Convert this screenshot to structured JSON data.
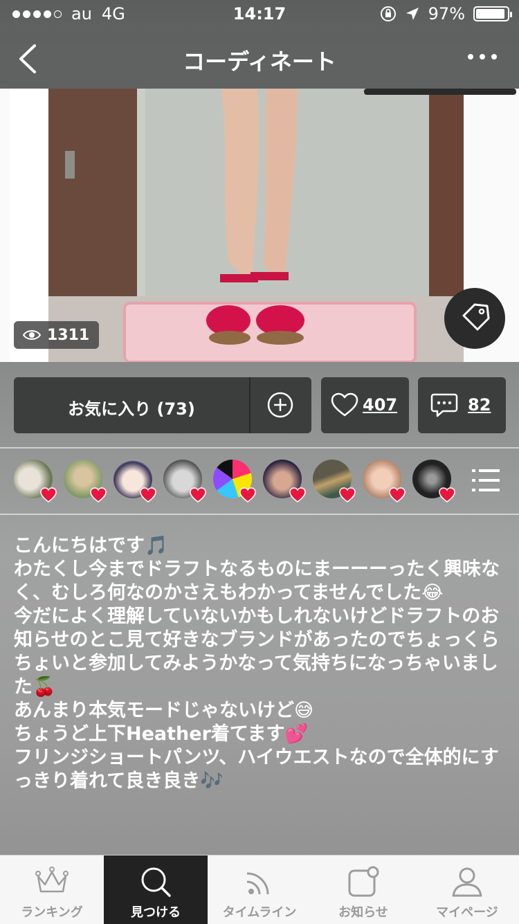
{
  "status_bar": {
    "carrier": "au",
    "network": "4G",
    "time": "14:17",
    "battery": "97%",
    "signal_bars": 4
  },
  "nav": {
    "title": "コーディネート",
    "back_icon": "chevron-left-icon",
    "more_icon": "more-dots-icon"
  },
  "photo": {
    "view_count": "1311",
    "tag_icon": "price-tag-icon"
  },
  "actions": {
    "favorite_label": "お気に入り (73)",
    "like_count": "407",
    "comment_count": "82"
  },
  "likers": {
    "count_shown": 9,
    "list_icon": "list-icon"
  },
  "description": {
    "lines": [
      "こんにちはです🎵",
      "",
      "わたくし今までドラフトなるものにまーーーったく興味なく、むしろ何なのかさえもわかってませんでした😂",
      "今だによく理解していないかもしれないけどドラフトのお知らせのとこ見て好きなブランドがあったのでちょっくらちょいと参加してみようかなって気持ちになっちゃいました🍒",
      "",
      "あんまり本気モードじゃないけど😅",
      "",
      "ちょうど上下Heather着てます💕",
      "フリンジショートパンツ、ハイウエストなので全体的にすっきり着れて良き良き🎶"
    ]
  },
  "tab_bar": {
    "tabs": [
      {
        "label": "ランキング",
        "icon": "crown-icon",
        "active": false
      },
      {
        "label": "見つける",
        "icon": "search-icon",
        "active": true
      },
      {
        "label": "タイムライン",
        "icon": "feed-icon",
        "active": false
      },
      {
        "label": "お知らせ",
        "icon": "notification-icon",
        "active": false
      },
      {
        "label": "マイページ",
        "icon": "person-icon",
        "active": false
      }
    ]
  },
  "colors": {
    "button_bg": "#3c3d3d",
    "heart_red": "#e8173f",
    "tab_active": "#222222"
  }
}
